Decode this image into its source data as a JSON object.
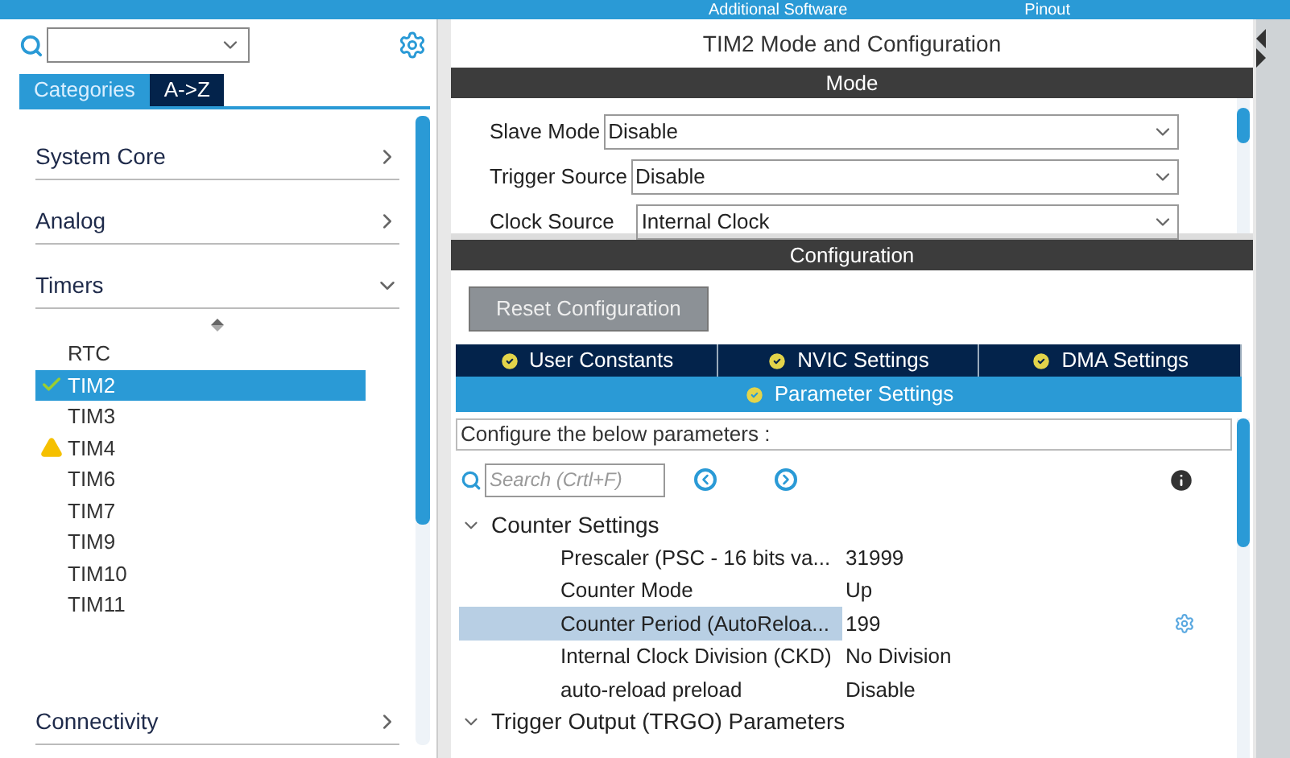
{
  "top_bar": {
    "items": [
      "Additional Software",
      "Pinout"
    ]
  },
  "sidebar": {
    "tabs": [
      {
        "label": "Categories",
        "selected": true
      },
      {
        "label": "A->Z",
        "selected": false
      }
    ],
    "categories": [
      {
        "label": "System Core",
        "expanded": false
      },
      {
        "label": "Analog",
        "expanded": false
      },
      {
        "label": "Timers",
        "expanded": true,
        "children": [
          {
            "label": "RTC",
            "kind": "plain",
            "selected": false
          },
          {
            "label": "TIM2",
            "kind": "ok",
            "selected": true
          },
          {
            "label": "TIM3",
            "kind": "plain",
            "selected": false
          },
          {
            "label": "TIM4",
            "kind": "warning",
            "selected": false
          },
          {
            "label": "TIM6",
            "kind": "plain",
            "selected": false
          },
          {
            "label": "TIM7",
            "kind": "plain",
            "selected": false
          },
          {
            "label": "TIM9",
            "kind": "plain",
            "selected": false
          },
          {
            "label": "TIM10",
            "kind": "plain",
            "selected": false
          },
          {
            "label": "TIM11",
            "kind": "plain",
            "selected": false
          }
        ]
      },
      {
        "label": "Connectivity",
        "expanded": false
      }
    ]
  },
  "main": {
    "title": "TIM2 Mode and Configuration",
    "mode_header": "Mode",
    "mode_fields": [
      {
        "label": "Slave Mode",
        "value": "Disable"
      },
      {
        "label": "Trigger Source",
        "value": "Disable"
      },
      {
        "label": "Clock Source",
        "value": "Internal Clock"
      }
    ],
    "config_header": "Configuration",
    "reset_button": "Reset Configuration",
    "tabs": [
      {
        "label": "User Constants",
        "selected": false
      },
      {
        "label": "NVIC Settings",
        "selected": false
      },
      {
        "label": "DMA Settings",
        "selected": false
      },
      {
        "label": "Parameter Settings",
        "selected": true
      }
    ],
    "hint": "Configure the below parameters :",
    "search": {
      "placeholder": "Search (Crtl+F)"
    },
    "groups": [
      {
        "label": "Counter Settings",
        "expanded": true,
        "rows": [
          {
            "name": "Prescaler (PSC - 16 bits va...",
            "value": "31999",
            "selected": false
          },
          {
            "name": "Counter Mode",
            "value": "Up",
            "selected": false
          },
          {
            "name": "Counter Period (AutoReloa...",
            "value": "199",
            "selected": true
          },
          {
            "name": "Internal Clock Division (CKD)",
            "value": "No Division",
            "selected": false
          },
          {
            "name": "auto-reload preload",
            "value": "Disable",
            "selected": false
          }
        ]
      },
      {
        "label": "Trigger Output (TRGO) Parameters",
        "expanded": true
      }
    ]
  }
}
